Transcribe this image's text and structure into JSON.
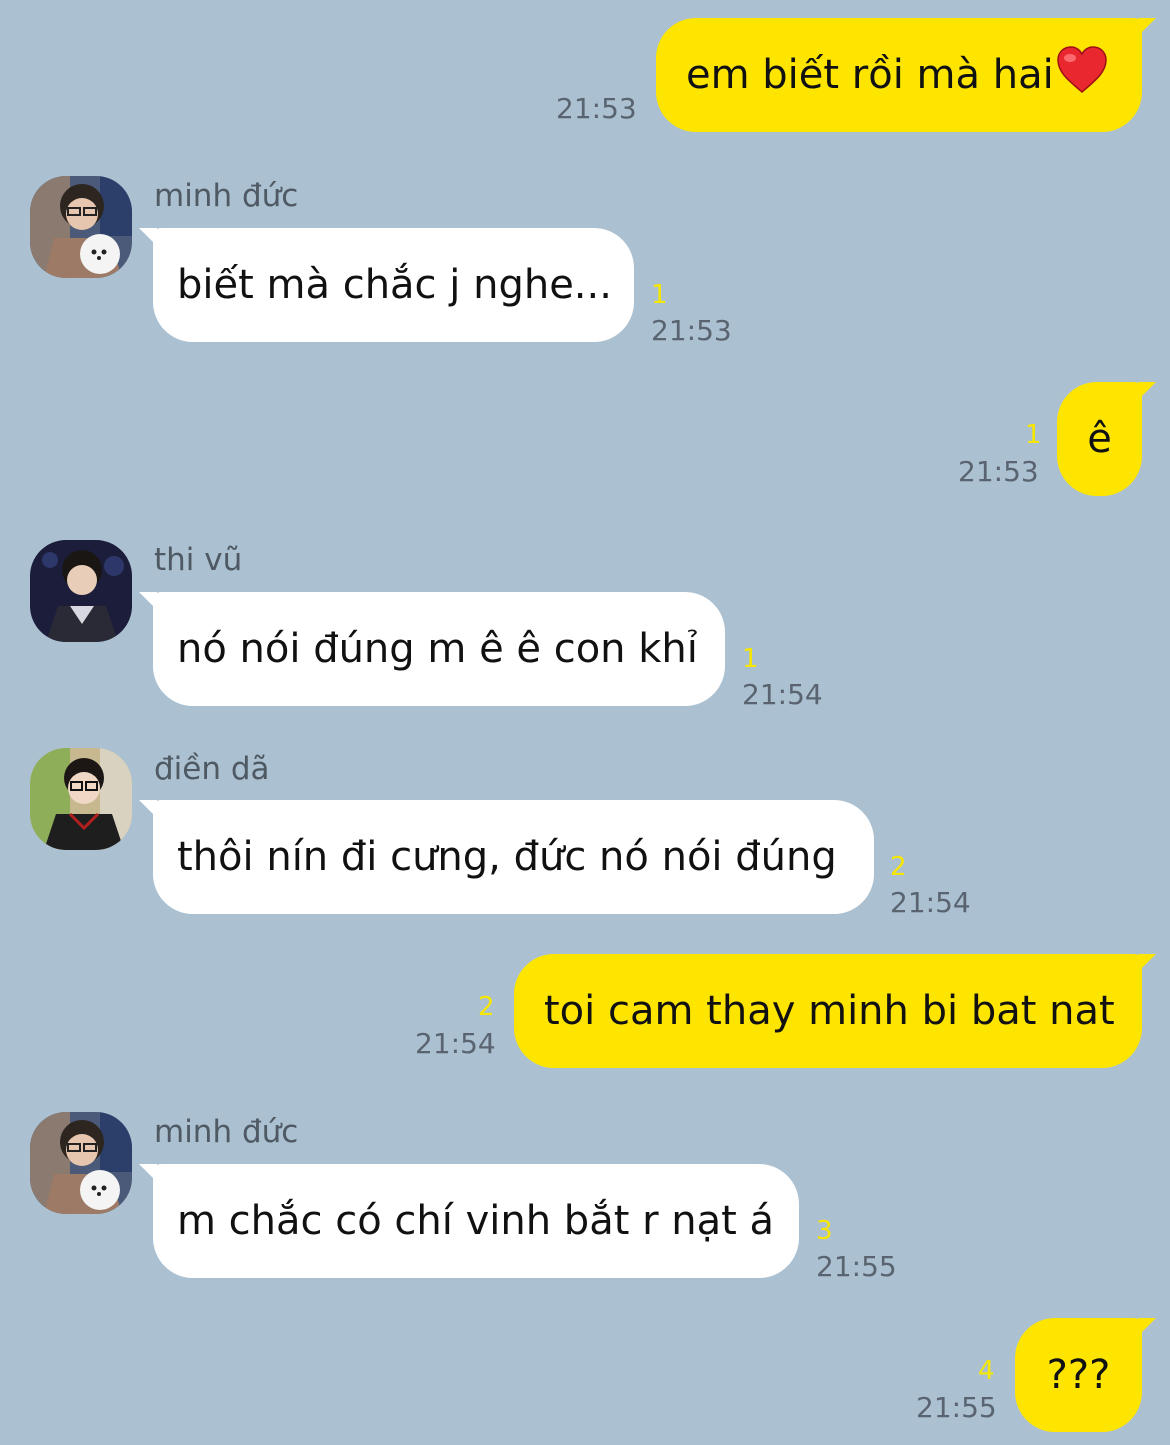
{
  "messages": [
    {
      "side": "mine",
      "text": "em biết rồi mà hai",
      "emoji": "heart-icon",
      "time": "21:53",
      "unread": ""
    },
    {
      "side": "theirs",
      "sender": "minh đức",
      "text": "biết mà chắc j nghe...",
      "time": "21:53",
      "unread": "1"
    },
    {
      "side": "mine",
      "text": "ê",
      "time": "21:53",
      "unread": "1"
    },
    {
      "side": "theirs",
      "sender": "thi vũ",
      "text": "nó nói đúng m ê ê con khỉ",
      "time": "21:54",
      "unread": "1"
    },
    {
      "side": "theirs",
      "sender": "điền dã",
      "text": "thôi nín đi cưng, đức nó nói đúng",
      "time": "21:54",
      "unread": "2"
    },
    {
      "side": "mine",
      "text": "toi cam thay minh bi bat nat",
      "time": "21:54",
      "unread": "2"
    },
    {
      "side": "theirs",
      "sender": "minh đức",
      "text": "m chắc có chí vinh bắt r nạt á",
      "time": "21:55",
      "unread": "3"
    },
    {
      "side": "mine",
      "text": "???",
      "time": "21:55",
      "unread": "4"
    }
  ],
  "colors": {
    "background": "#abc1d1",
    "my_bubble": "#fee500",
    "their_bubble": "#ffffff",
    "unread_count": "#f6e600",
    "timestamp": "#5a6470"
  }
}
